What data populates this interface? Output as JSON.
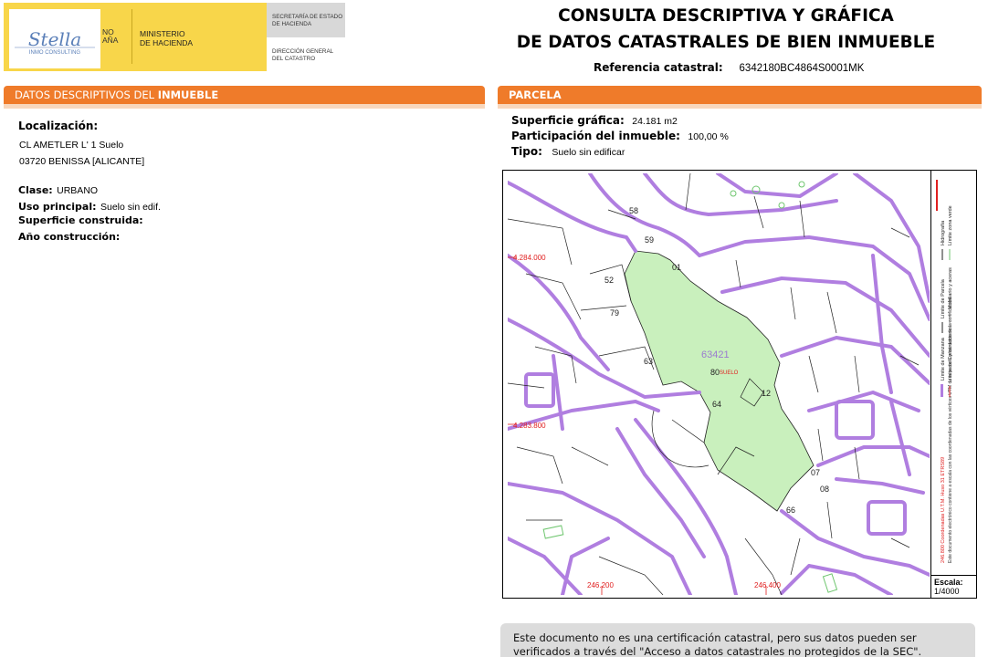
{
  "header": {
    "gov_lines": [
      "NO",
      "AÑA"
    ],
    "ministerio": [
      "MINISTERIO",
      "DE HACIENDA"
    ],
    "secretaria": [
      "SECRETARÍA DE ESTADO",
      "DE HACIENDA"
    ],
    "direccion": [
      "DIRECCIÓN GENERAL",
      "DEL CATASTRO"
    ],
    "logo_text": "Stella",
    "logo_subtext": "INMO CONSULTING"
  },
  "title": {
    "line1": "CONSULTA DESCRIPTIVA Y GRÁFICA",
    "line2": "DE DATOS CATASTRALES DE BIEN INMUEBLE"
  },
  "reference": {
    "label": "Referencia catastral:",
    "value": "6342180BC4864S0001MK"
  },
  "left_section": {
    "heading_pre": "DATOS DESCRIPTIVOS DEL ",
    "heading_bold": "INMUEBLE",
    "localizacion_label": "Localización:",
    "address_line1": "CL AMETLER L' 1 Suelo",
    "address_line2": "03720 BENISSA [ALICANTE]",
    "clase_label": "Clase:",
    "clase_value": "URBANO",
    "uso_label": "Uso principal:",
    "uso_value": "Suelo sin edif.",
    "superficie_label": "Superficie construida:",
    "anio_label": "Año construcción:"
  },
  "right_section": {
    "heading": "PARCELA",
    "superficie_label": "Superficie gráfica:",
    "superficie_value": "24.181 m2",
    "participacion_label": "Participación del inmueble:",
    "participacion_value": "100,00 %",
    "tipo_label": "Tipo:",
    "tipo_value": "Suelo sin edificar"
  },
  "map": {
    "parcel_label": "63421",
    "parcel_sublabel": "SUELO",
    "labels": [
      "58",
      "59",
      "01",
      "52",
      "79",
      "63",
      "80",
      "64",
      "12",
      "07",
      "08",
      "66"
    ],
    "coord_y_top": "4.284.000",
    "coord_y_bottom": "4.283.800",
    "coord_x_left": "246.200",
    "coord_x_right": "246.400",
    "legend_lines": [
      "Límite de Manzana",
      "Límite de Parcela",
      "Límite de Construcciones",
      "Mobiliario y aceras",
      "Límite zona verde",
      "Hidrografía"
    ],
    "legend_coords": "246.800 Coordenadas U.T.M. Huso 31 ETRS89",
    "legend_note": "Este documento electrónico contiene a escala con las coordenadas de los vértices UTM de la parcela y los datos de la certificación.",
    "scale_label": "Escala:",
    "scale_value": "1/4000",
    "colors": {
      "manzana": "#b07ee0",
      "parcel_fill": "#c9f0bd",
      "coords": "#e02020"
    }
  },
  "note": {
    "text": "Este documento no es una certificación catastral, pero sus datos pueden ser verificados a través del \"Acceso a datos catastrales no protegidos de la SEC\"."
  }
}
